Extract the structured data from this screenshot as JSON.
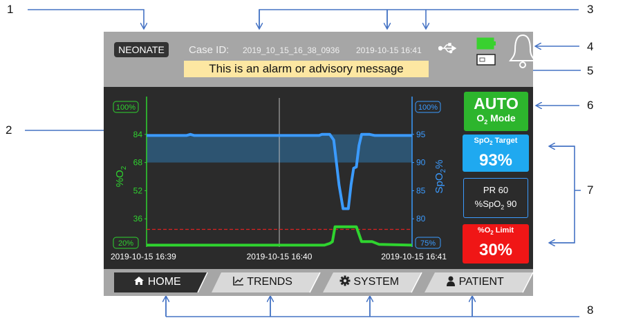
{
  "header": {
    "mode_badge": "NEONATE",
    "case_label": "Case ID:",
    "case_id": "2019_10_15_16_38_0936",
    "datetime": "2019-10-15 16:41",
    "alarm_message": "This is an alarm or advisory message",
    "icons": [
      "usb-icon",
      "battery-icon",
      "card-icon",
      "bell-icon"
    ],
    "battery_color": "#39d12f"
  },
  "side_panel": {
    "mode_main": "AUTO",
    "mode_sub": "O",
    "mode_sub_sub": "2",
    "mode_sub_tail": " Mode",
    "spo2_target_label_a": "SpO",
    "spo2_target_label_sub": "2",
    "spo2_target_label_b": " Target",
    "spo2_target_value": "93%",
    "pr_text": "PR 60",
    "spo2_text_a": "%SpO",
    "spo2_text_sub": "2",
    "spo2_text_b": " 90",
    "o2_limit_label_a": "%O",
    "o2_limit_label_sub": "2",
    "o2_limit_label_b": " Limit",
    "o2_limit_value": "30%",
    "colors": {
      "auto": "#2db52d",
      "target": "#1fa9f0",
      "limit": "#f01616"
    }
  },
  "tabs": [
    {
      "label": "HOME",
      "icon": "home-icon"
    },
    {
      "label": "TRENDS",
      "icon": "trend-icon"
    },
    {
      "label": "SYSTEM",
      "icon": "gear-icon"
    },
    {
      "label": "PATIENT",
      "icon": "person-icon"
    }
  ],
  "callouts": [
    "1",
    "2",
    "3",
    "4",
    "5",
    "6",
    "7",
    "8"
  ],
  "chart_data": {
    "type": "line",
    "left_axis": {
      "label_a": "%O",
      "label_sub": "2",
      "ticks": [
        "84",
        "68",
        "52",
        "36"
      ],
      "range_top": "100%",
      "range_bottom": "20%",
      "ylim": [
        20,
        100
      ],
      "color": "#2fd42f"
    },
    "right_axis": {
      "label_a": "SpO",
      "label_sub": "2",
      "label_b": "%",
      "ticks": [
        "95",
        "90",
        "85",
        "80"
      ],
      "range_top": "100%",
      "range_bottom": "75%",
      "ylim": [
        75,
        100
      ],
      "color": "#3b9bff"
    },
    "x_labels": [
      "2019-10-15 16:39",
      "2019-10-15 16:40",
      "2019-10-15 16:41"
    ],
    "x_range_minutes": [
      0,
      2
    ],
    "target_band": [
      90,
      95
    ],
    "o2_limit": 30,
    "series": [
      {
        "color": "#3b9bff",
        "axis": "right",
        "points": [
          [
            0,
            94.8
          ],
          [
            0.3,
            94.8
          ],
          [
            0.33,
            95
          ],
          [
            0.36,
            94.8
          ],
          [
            1.3,
            94.8
          ],
          [
            1.32,
            95
          ],
          [
            1.38,
            95
          ],
          [
            1.41,
            94
          ],
          [
            1.43,
            90
          ],
          [
            1.45,
            86
          ],
          [
            1.48,
            81.8
          ],
          [
            1.52,
            81.8
          ],
          [
            1.54,
            86
          ],
          [
            1.56,
            89
          ],
          [
            1.58,
            89.2
          ],
          [
            1.6,
            93
          ],
          [
            1.62,
            95
          ],
          [
            1.68,
            95
          ],
          [
            1.72,
            94.8
          ],
          [
            2,
            94.8
          ]
        ]
      },
      {
        "color": "#2fd42f",
        "axis": "left",
        "points": [
          [
            0,
            21
          ],
          [
            1.34,
            21
          ],
          [
            1.38,
            22
          ],
          [
            1.4,
            23
          ],
          [
            1.42,
            31.5
          ],
          [
            1.58,
            31.5
          ],
          [
            1.62,
            23
          ],
          [
            1.7,
            23
          ],
          [
            1.75,
            21.5
          ],
          [
            2,
            21
          ]
        ]
      }
    ]
  }
}
